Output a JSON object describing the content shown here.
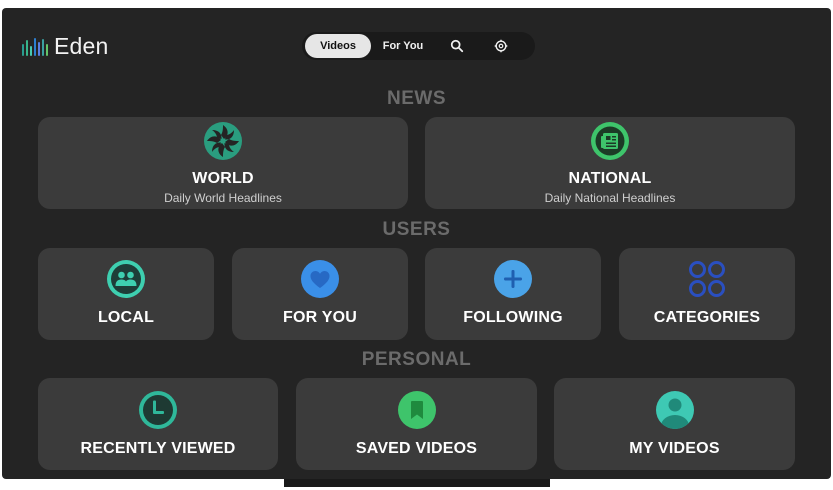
{
  "brand": {
    "name": "Eden",
    "bar_colors": [
      "#2a9d8f",
      "#37b58a",
      "#48c9b0",
      "#2d7fd0",
      "#5b7fe0",
      "#3aa0a0",
      "#62c46a"
    ]
  },
  "nav": {
    "videos_label": "Videos",
    "for_you_label": "For You",
    "search_icon": "search-icon",
    "settings_icon": "gear-icon"
  },
  "sections": {
    "news": "NEWS",
    "users": "USERS",
    "personal": "PERSONAL"
  },
  "news": {
    "world": {
      "label": "WORLD",
      "sub": "Daily World Headlines",
      "icon": "aperture-icon",
      "color": "#2a9d7f"
    },
    "national": {
      "label": "NATIONAL",
      "sub": "Daily National Headlines",
      "icon": "newspaper-icon",
      "color": "#3ec46b"
    }
  },
  "users": {
    "local": {
      "label": "LOCAL",
      "icon": "people-icon",
      "color": "#3ecfb0"
    },
    "for_you": {
      "label": "FOR YOU",
      "icon": "heart-icon",
      "color": "#3a8fe8"
    },
    "following": {
      "label": "FOLLOWING",
      "icon": "plus-icon",
      "color": "#4aa3e8"
    },
    "categories": {
      "label": "CATEGORIES",
      "icon": "four-circles-icon",
      "color": "#2a4fc0"
    }
  },
  "personal": {
    "recently_viewed": {
      "label": "RECENTLY VIEWED",
      "icon": "clock-icon",
      "color": "#2fb89a"
    },
    "saved_videos": {
      "label": "SAVED VIDEOS",
      "icon": "bookmark-icon",
      "color": "#3ec46b"
    },
    "my_videos": {
      "label": "MY VIDEOS",
      "icon": "user-icon",
      "color": "#3ec9b4"
    }
  }
}
